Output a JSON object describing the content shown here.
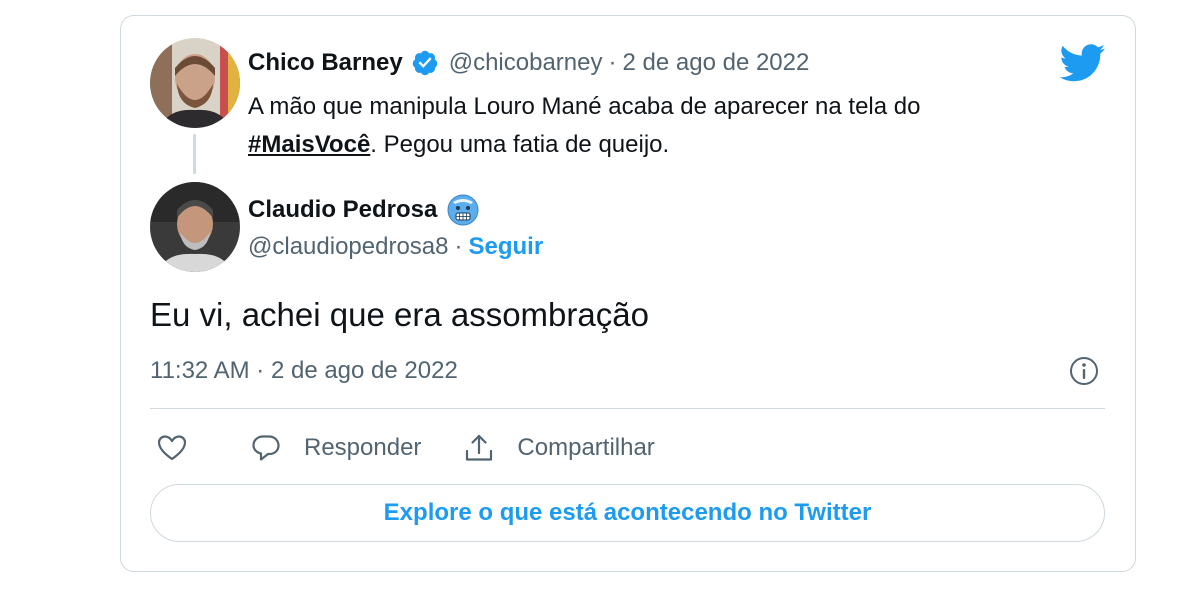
{
  "quoted_tweet": {
    "display_name": "Chico Barney",
    "handle": "@chicobarney",
    "separator": "·",
    "date": "2 de ago de 2022",
    "text_part1": "A mão que manipula Louro Mané acaba de aparecer na tela do ",
    "hashtag": "#MaisVocê",
    "text_part2": ". Pegou uma fatia de queijo.",
    "avatar_icon": "avatar-photo",
    "verified_icon": "verified-badge-icon"
  },
  "reply_tweet": {
    "display_name": "Claudio Pedrosa",
    "emoji_icon": "cold-face-emoji-icon",
    "handle": "@claudiopedrosa8",
    "separator": "·",
    "follow_label": "Seguir",
    "text": "Eu vi, achei que era assombração",
    "timestamp": "11:32 AM · 2 de ago de 2022"
  },
  "actions": {
    "like_icon": "heart-icon",
    "reply_label": "Responder",
    "share_label": "Compartilhar"
  },
  "explore_button": {
    "label": "Explore o que está acontecendo no Twitter"
  },
  "colors": {
    "brand": "#1d9bf0",
    "text": "#0f1419",
    "secondary": "#536471",
    "border": "#cfd9de"
  }
}
